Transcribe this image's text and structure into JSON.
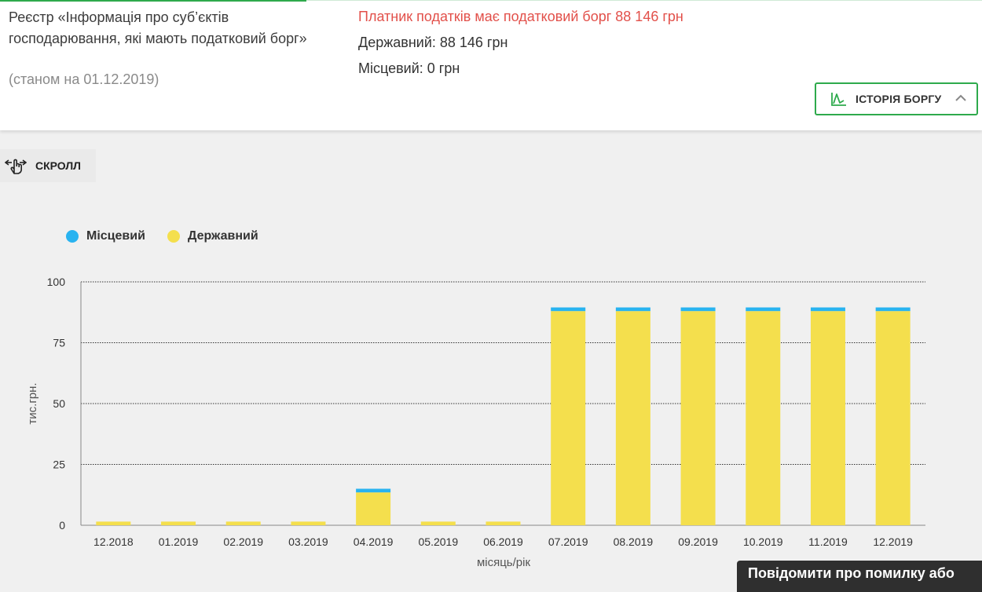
{
  "header": {
    "registry_title": "Реєстр «Інформація про суб’єктів господарювання, які мають податковий борг»",
    "registry_date": "(станом на 01.12.2019)",
    "debt_status": "Платник податків має податковий борг 88 146 грн",
    "state_debt": "Державний: 88 146 грн",
    "local_debt": "Місцевий: 0 грн",
    "history_button": "ІСТОРІЯ БОРГУ",
    "history_icon": "line-chart-icon",
    "chevron_icon": "chevron-up-icon"
  },
  "scroll": {
    "label": "СКРОЛЛ",
    "icon": "swipe-hand-icon"
  },
  "colors": {
    "accent": "#2eaa4c",
    "debt_red": "#e2504a",
    "local": "#29b3f0",
    "state": "#f4df4d"
  },
  "chart_data": {
    "type": "bar",
    "stacked": true,
    "categories": [
      "12.2018",
      "01.2019",
      "02.2019",
      "03.2019",
      "04.2019",
      "05.2019",
      "06.2019",
      "07.2019",
      "08.2019",
      "09.2019",
      "10.2019",
      "11.2019",
      "12.2019"
    ],
    "series": [
      {
        "name": "Державний",
        "color": "#f4df4d",
        "values": [
          1.5,
          1.5,
          1.5,
          1.5,
          13.5,
          1.5,
          1.5,
          88,
          88,
          88,
          88,
          88,
          88
        ]
      },
      {
        "name": "Місцевий",
        "color": "#29b3f0",
        "values": [
          0,
          0,
          0,
          0,
          1.5,
          0,
          0,
          1.5,
          1.5,
          1.5,
          1.5,
          1.5,
          1.5
        ]
      }
    ],
    "legend_order": [
      "Місцевий",
      "Державний"
    ],
    "legend_position": "top-left",
    "ylabel": "тис.грн.",
    "xlabel": "місяць/рік",
    "yticks": [
      0,
      25,
      50,
      75,
      100
    ],
    "ylim": [
      0,
      100
    ],
    "grid": true
  },
  "footer": {
    "report_label": "Повідомити про помилку або"
  }
}
